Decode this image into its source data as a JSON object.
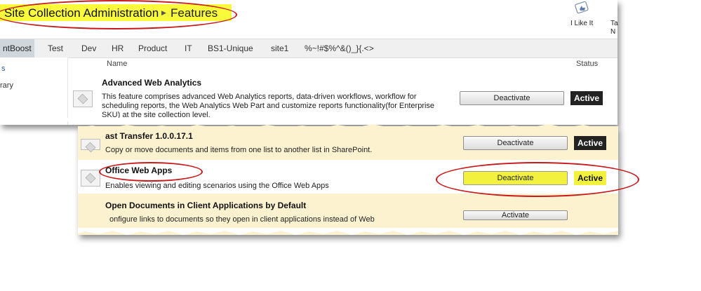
{
  "header": {
    "breadcrumb_site": "Site Collection Administration",
    "breadcrumb_page": "Features",
    "like_label": "I Like It",
    "tags_label": "Ta N"
  },
  "nav": {
    "items": [
      "ntBoost",
      "Test",
      "Dev",
      "HR",
      "Product",
      "IT",
      "BS1-Unique",
      "site1",
      "%~!#$%^&()_}{.<>"
    ]
  },
  "left_nav": {
    "item1": "s",
    "item2": "rary"
  },
  "columns": {
    "name": "Name",
    "status": "Status"
  },
  "features": [
    {
      "title": "Advanced Web Analytics",
      "description": "This feature comprises advanced Web Analytics reports, data-driven workflows, workflow for scheduling reports, the Web Analytics Web Part and customize reports functionality(for Enterprise SKU) at the site collection level.",
      "button": "Deactivate",
      "status": "Active"
    },
    {
      "title": "ast Transfer 1.0.0.17.1",
      "description": "Copy or move documents and items from one list to another list in SharePoint.",
      "button": "Deactivate",
      "status": "Active"
    },
    {
      "title": "Office Web Apps",
      "description": "Enables viewing and editing scenarios using the Office Web Apps",
      "button": "Deactivate",
      "status": "Active"
    },
    {
      "title": "Open Documents in Client Applications by Default",
      "description": "onfigure links to documents so they open in client applications instead of Web",
      "button": "Activate",
      "status": ""
    }
  ],
  "colors": {
    "highlight": "#f2f23e",
    "annotation": "#c81a1a",
    "row_cream": "#fdf2d0",
    "badge_dark": "#222222"
  },
  "icons": {
    "like": "thumbs-up-tag-icon",
    "feature": "feature-puzzle-icon"
  }
}
